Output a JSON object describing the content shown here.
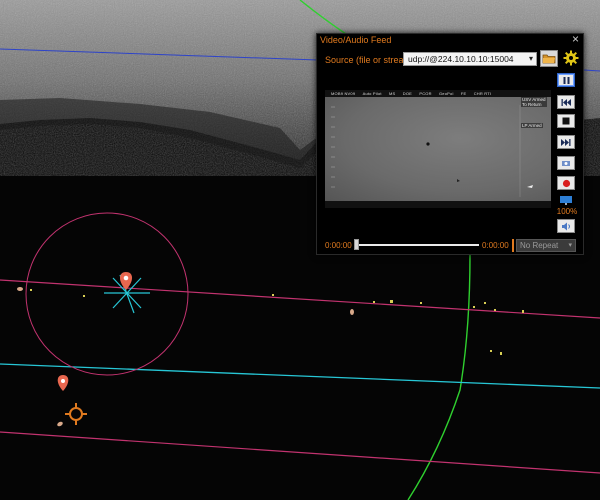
{
  "feed_panel": {
    "title": "Video/Audio Feed",
    "close_symbol": "×",
    "source_label": "Source (file or stream):",
    "source_value": "udp://@224.10.10.10:15004",
    "open_file_icon": "folder-icon",
    "settings_icon": "gear-icon",
    "video_overlay": {
      "top_bar_items": [
        "MOB9 NV09",
        "Auto Pilot",
        "MS",
        "DOE",
        "PCOR",
        "GeoPol",
        "FE",
        "CHR RTI"
      ],
      "right_top_text": [
        "USV Armed",
        "To Return"
      ],
      "right_mid_text": "LP Armed"
    },
    "controls": {
      "play_pause_icon": "pause-icon",
      "previous_icon": "skip-back-icon",
      "stop_icon": "stop-icon",
      "next_icon": "skip-forward-icon",
      "snapshot_icon": "snapshot-icon",
      "record_icon": "record-icon",
      "display_icon": "monitor-icon",
      "volume_icon": "speaker-icon",
      "volume_percent": "100%"
    },
    "playback": {
      "current_time": "0:00:00",
      "total_time": "0:00:00",
      "position_fraction": 0.0,
      "repeat_value": "No Repeat"
    },
    "colors": {
      "accent": "#e07a1f",
      "panel_bg": "#000000"
    }
  },
  "map": {
    "markers": [
      {
        "icon": "location-pin-icon",
        "color": "#e8674f"
      },
      {
        "icon": "location-pin-icon",
        "color": "#e8674f"
      },
      {
        "icon": "target-crosshair-icon",
        "color": "#e07a1f"
      }
    ],
    "colors": {
      "range_ring": "#c2336f",
      "magenta_lines": "#c2336f",
      "cyan_line": "#27c7d6",
      "green_arc": "#2fd02f",
      "blue_line": "#2d43c9",
      "contacts": "#d8cf55"
    }
  }
}
